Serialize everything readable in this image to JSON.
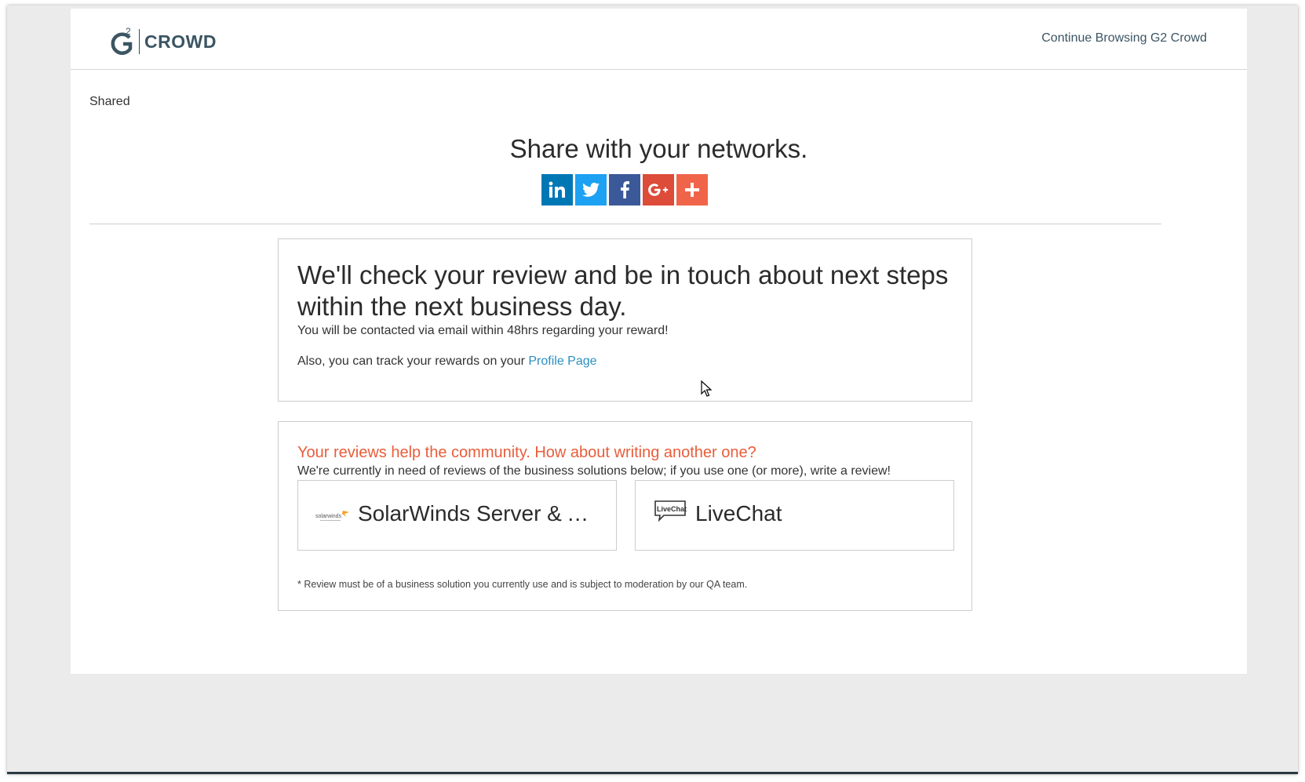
{
  "header": {
    "logo_superscript": "2",
    "logo_letter": "G",
    "logo_word": "CROWD",
    "continue_link": "Continue Browsing G2 Crowd"
  },
  "status_label": "Shared",
  "share": {
    "title": "Share with your networks.",
    "buttons": [
      {
        "network": "LinkedIn",
        "icon": "linkedin-icon",
        "color": "#0077b5"
      },
      {
        "network": "Twitter",
        "icon": "twitter-icon",
        "color": "#1da1f2"
      },
      {
        "network": "Facebook",
        "icon": "facebook-icon",
        "color": "#3b5998"
      },
      {
        "network": "Google+",
        "icon": "google-plus-icon",
        "color": "#dd4b39"
      },
      {
        "network": "More",
        "icon": "plus-icon",
        "color": "#f0654a"
      }
    ]
  },
  "review_status": {
    "heading": "We'll check your review and be in touch about next steps within the next business day.",
    "contact_note": "You will be contacted via email within 48hrs regarding your reward!",
    "track_prefix": "Also, you can track your rewards on your ",
    "profile_link": "Profile Page"
  },
  "community": {
    "heading": "Your reviews help the community. How about writing another one?",
    "subheading": "We're currently in need of reviews of the business solutions below; if you use one (or more), write a review!",
    "products": [
      {
        "name": "SolarWinds Server & Application Monitor",
        "logo_text": "solarwinds"
      },
      {
        "name": "LiveChat",
        "logo_text": "LiveChat"
      }
    ],
    "disclaimer": "* Review must be of a business solution you currently use and is subject to moderation by our QA team."
  },
  "colors": {
    "accent_orange": "#e85d3a",
    "link_blue": "#2b8fbf",
    "brand_slate": "#3b5563"
  }
}
